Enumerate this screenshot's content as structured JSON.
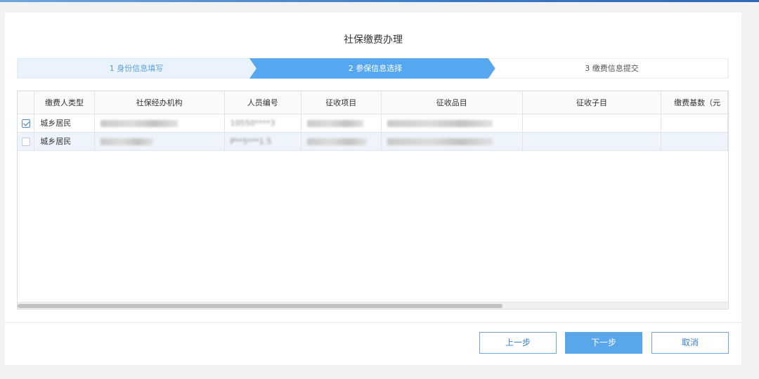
{
  "dialog": {
    "title": "社保缴费办理"
  },
  "steps": [
    {
      "label": "1 身份信息填写",
      "state": "done"
    },
    {
      "label": "2 参保信息选择",
      "state": "active"
    },
    {
      "label": "3 缴费信息提交",
      "state": "pending"
    }
  ],
  "colors": {
    "step_done_bg": "#eaf3fc",
    "step_active_bg": "#55a7ef",
    "primary_button": "#5aa6ea"
  },
  "table": {
    "headers": [
      "缴费人类型",
      "社保经办机构",
      "人员编号",
      "征收项目",
      "征收品目",
      "征收子目",
      "缴费基数（元"
    ],
    "rows": [
      {
        "checked": true,
        "type": "城乡居民",
        "agency": "",
        "person_id": "10550****3",
        "item": "",
        "subitem": "",
        "child": "",
        "base": ""
      },
      {
        "checked": false,
        "type": "城乡居民",
        "agency": "",
        "person_id": "P**5***1.5",
        "item": "",
        "subitem": "",
        "child": "",
        "base": ""
      }
    ]
  },
  "buttons": {
    "prev": "上一步",
    "next": "下一步",
    "cancel": "取消"
  }
}
